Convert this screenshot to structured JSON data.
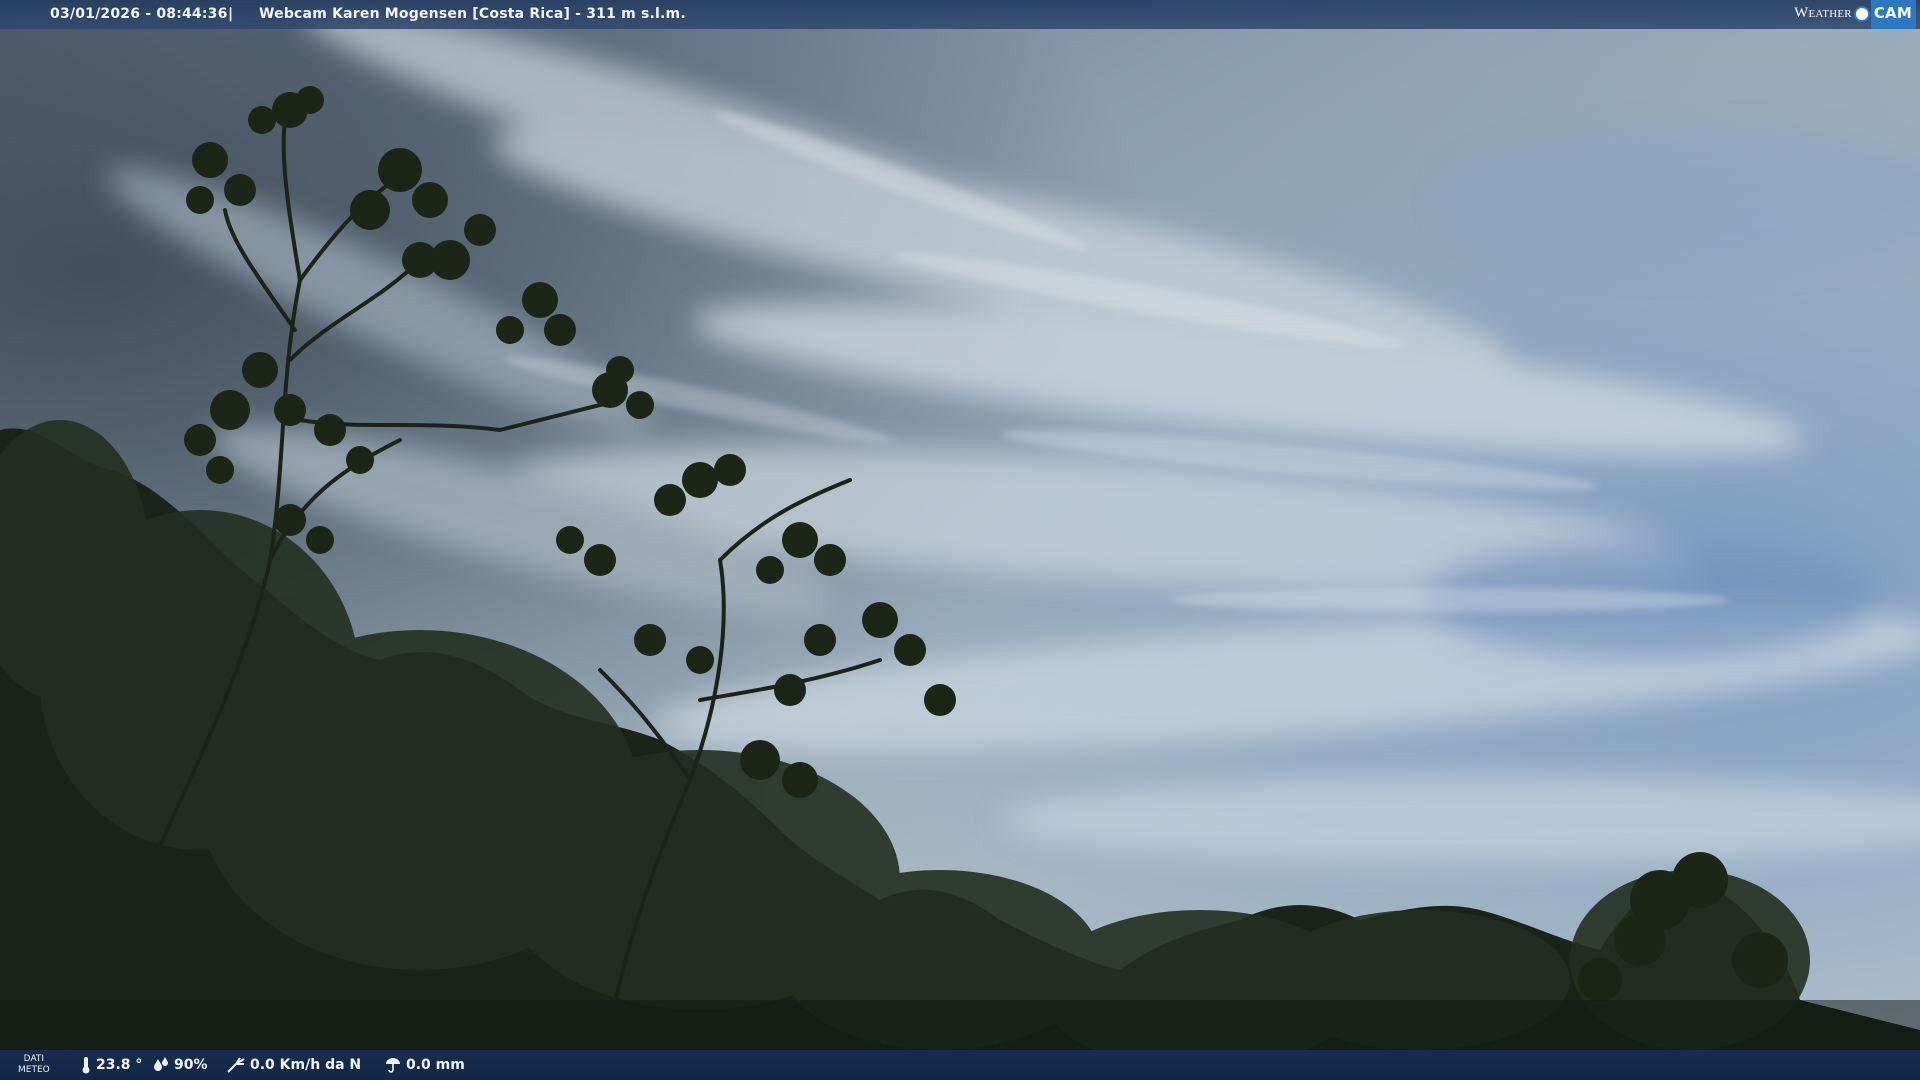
{
  "header": {
    "datetime": "03/01/2026 - 08:44:36",
    "separator": "|",
    "title": "Webcam Karen Mogensen [Costa Rica]  - 311 m s.l.m.",
    "brand_word": "Weather",
    "brand_cam": "CAM"
  },
  "weather": {
    "label_line1": "DATI",
    "label_line2": "METEO",
    "temperature": "23.8 °",
    "humidity": "90%",
    "wind": "0.0 Km/h da N",
    "rain": "0.0 mm"
  },
  "colors": {
    "bar_top": "#2b4568",
    "bar_bottom": "#17294a",
    "brand_blue": "#2a79c2",
    "sky_light": "#a9bac6",
    "sky_dark": "#5b6b7b",
    "foliage": "#1b2519"
  },
  "icons": {
    "temperature": "thermometer-icon",
    "humidity": "droplets-icon",
    "wind": "wind-icon",
    "rain": "rain-gauge-icon"
  }
}
